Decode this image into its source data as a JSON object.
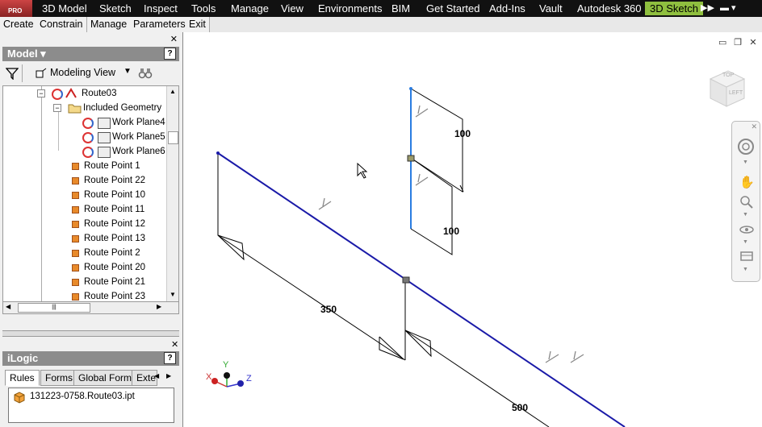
{
  "menubar": {
    "logo_label": "PRO",
    "tabs": [
      "3D Model",
      "Sketch",
      "Inspect",
      "Tools",
      "Manage",
      "View",
      "Environments",
      "BIM",
      "Get Started",
      "Add-Ins",
      "Vault",
      "Autodesk 360"
    ],
    "active_tab": "3D Sketch"
  },
  "subbar": {
    "items": [
      "Create",
      "Constrain",
      "Manage",
      "Parameters",
      "Exit"
    ]
  },
  "model_panel": {
    "title": "Model ▾",
    "help": "?",
    "view_label": "Modeling View",
    "tree": {
      "route": "Route03",
      "included_geometry": "Included Geometry",
      "work_planes": [
        "Work Plane4",
        "Work Plane5",
        "Work Plane6"
      ],
      "route_points": [
        "Route Point 1",
        "Route Point 22",
        "Route Point 10",
        "Route Point 11",
        "Route Point 12",
        "Route Point 13",
        "Route Point 2",
        "Route Point 20",
        "Route Point 21",
        "Route Point 23"
      ]
    }
  },
  "ilogic_panel": {
    "title": "iLogic",
    "help": "?",
    "tabs": [
      "Rules",
      "Forms",
      "Global Forms",
      "Exte"
    ],
    "rule_file": "131223-0758.Route03.ipt"
  },
  "viewport": {
    "dimensions": [
      "100",
      "100",
      "350",
      "500"
    ],
    "axes": {
      "x": "X",
      "y": "Y",
      "z": "Z"
    },
    "viewcube_labels": [
      "LEFT",
      "TOP"
    ]
  },
  "colors": {
    "accent": "#8fbf3f",
    "route_line": "#1a1aa8",
    "selected_line": "#2a7de1",
    "dark_bar": "#111111"
  }
}
